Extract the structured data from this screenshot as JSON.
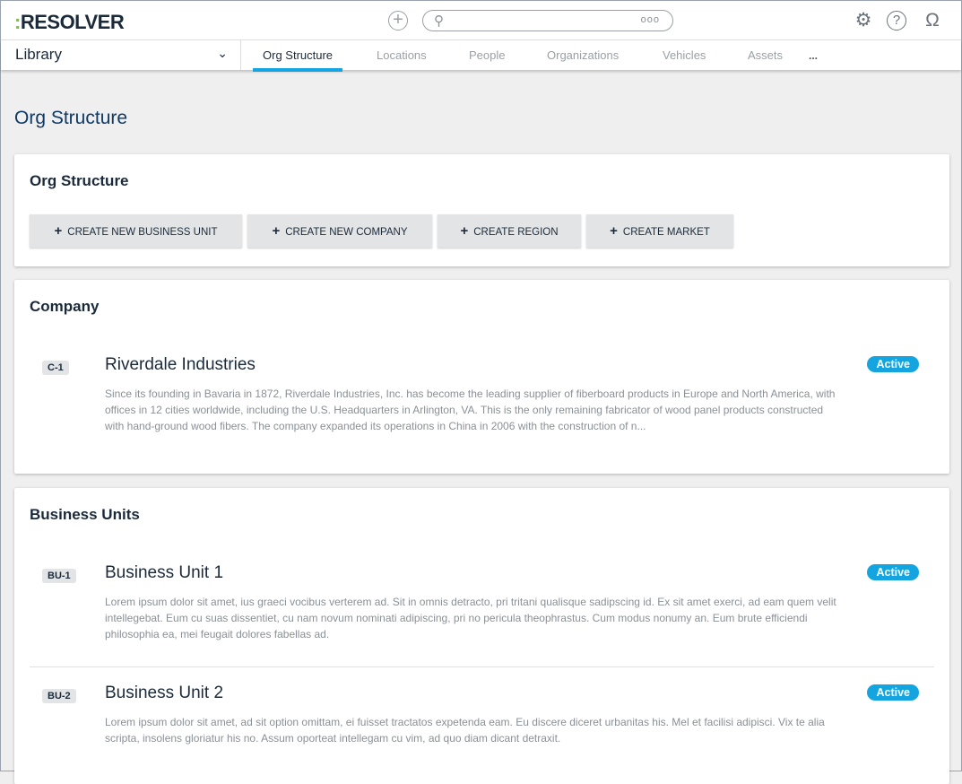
{
  "header": {
    "logo": "RESOLVER",
    "logo_mark": ":",
    "search_placeholder": "",
    "search_options": "ooo"
  },
  "nav": {
    "dropdown": "Library",
    "tabs": [
      "Org Structure",
      "Locations",
      "People",
      "Organizations",
      "Vehicles",
      "Assets"
    ],
    "more": "..."
  },
  "page_title": "Org Structure",
  "org_card": {
    "title": "Org Structure",
    "buttons": [
      "CREATE NEW BUSINESS UNIT",
      "CREATE NEW COMPANY",
      "CREATE REGION",
      "CREATE MARKET"
    ]
  },
  "company_card": {
    "title": "Company",
    "items": [
      {
        "id": "C-1",
        "name": "Riverdale Industries",
        "status": "Active",
        "description": "Since its founding in Bavaria in 1872, Riverdale Industries, Inc. has become the leading supplier of fiberboard products in Europe and North America, with offices in 12 cities worldwide, including the U.S. Headquarters in Arlington, VA. This is the only remaining fabricator of wood panel products constructed with hand-ground wood fibers. The company expanded its operations in China in 2006 with the construction of n..."
      }
    ]
  },
  "bu_card": {
    "title": "Business Units",
    "items": [
      {
        "id": "BU-1",
        "name": "Business Unit 1",
        "status": "Active",
        "description": "Lorem ipsum dolor sit amet, ius graeci vocibus verterem ad. Sit in omnis detracto, pri tritani qualisque sadipscing id. Ex sit amet exerci, ad eam quem velit intellegebat. Eum cu suas dissentiet, cu nam novum nominati adipiscing, pri no pericula theophrastus. Cum modus nonumy an. Eum brute efficiendi philosophia ea, mei feugait dolores fabellas ad."
      },
      {
        "id": "BU-2",
        "name": "Business Unit 2",
        "status": "Active",
        "description": "Lorem ipsum dolor sit amet, ad sit option omittam, ei fuisset tractatos expetenda eam. Eu discere diceret urbanitas his. Mel et facilisi adipisci. Vix te alia scripta, insolens gloriatur his no. Assum oporteat intellegam cu vim, ad quo diam dicant detraxit."
      }
    ]
  }
}
